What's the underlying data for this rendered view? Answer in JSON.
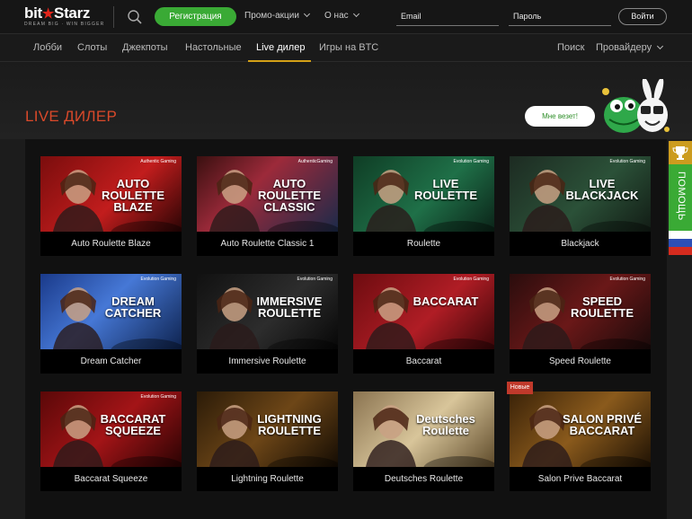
{
  "header": {
    "logo_main": "bitStarz",
    "logo_sub": "DREAM BIG · WIN BIGGER",
    "register_label": "Регистрация",
    "promo_label": "Промо-акции",
    "about_label": "О нас",
    "email_placeholder": "Email",
    "password_placeholder": "Пароль",
    "login_label": "Войти"
  },
  "secnav": {
    "items": [
      "Лобби",
      "Слоты",
      "Джекпоты",
      "Настольные",
      "Live дилер",
      "Игры на BTC"
    ],
    "active": "Live дилер",
    "search_label": "Поиск",
    "provider_label": "Провайдеру"
  },
  "page": {
    "title": "LIVE ДИЛЕР",
    "bubble": "Мне везет!"
  },
  "sidebar": {
    "help_label": "ПОМОЩЬ"
  },
  "badges": {
    "new": "Новые"
  },
  "games": [
    {
      "name": "Auto Roulette Blaze",
      "art": "AUTO ROULETTE BLAZE",
      "brand": "Authentic Gaming",
      "theme": "red-roulette"
    },
    {
      "name": "Auto Roulette Classic 1",
      "art": "AUTO ROULETTE CLASSIC",
      "brand": "AuthenticGaming",
      "theme": "blue-roulette"
    },
    {
      "name": "Roulette",
      "art": "LIVE ROULETTE",
      "brand": "Evolution Gaming",
      "theme": "green-roulette"
    },
    {
      "name": "Blackjack",
      "art": "LIVE BLACKJACK",
      "brand": "Evolution Gaming",
      "theme": "green-blackjack"
    },
    {
      "name": "Dream Catcher",
      "art": "DREAM CATCHER",
      "brand": "Evolution Gaming",
      "theme": "wheel"
    },
    {
      "name": "Immersive Roulette",
      "art": "IMMERSIVE ROULETTE",
      "brand": "Evolution Gaming",
      "theme": "dark-roulette"
    },
    {
      "name": "Baccarat",
      "art": "BACCARAT",
      "brand": "Evolution Gaming",
      "theme": "red-baccarat"
    },
    {
      "name": "Speed Roulette",
      "art": "SPEED ROULETTE",
      "brand": "Evolution Gaming",
      "theme": "speed"
    },
    {
      "name": "Baccarat Squeeze",
      "art": "BACCARAT SQUEEZE",
      "brand": "Evolution Gaming",
      "theme": "squeeze"
    },
    {
      "name": "Lightning Roulette",
      "art": "LIGHTNING ROULETTE",
      "brand": "",
      "theme": "lightning"
    },
    {
      "name": "Deutsches Roulette",
      "art": "Deutsches Roulette",
      "brand": "",
      "theme": "deutsch"
    },
    {
      "name": "Salon Prive Baccarat",
      "art": "SALON PRIVÉ BACCARAT",
      "brand": "",
      "theme": "salon"
    }
  ],
  "colors": {
    "accent_green": "#3aaa35",
    "title_orange": "#d9492a",
    "nav_underline": "#d4a017"
  }
}
